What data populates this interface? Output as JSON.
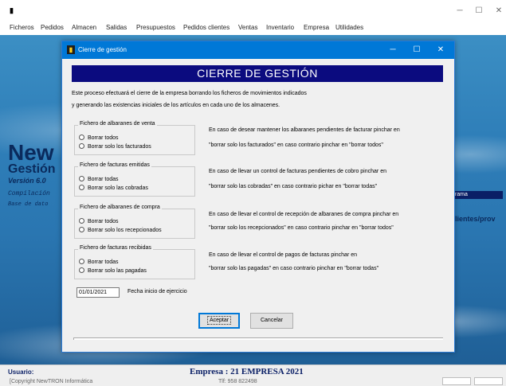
{
  "app": {
    "icon_glyph": "▮",
    "controls": {
      "minimize": "─",
      "maximize": "☐",
      "close": "✕"
    }
  },
  "menu": [
    "Ficheros",
    "Pedidos",
    "Almacen",
    "Salidas",
    "Presupuestos",
    "Pedidos clientes",
    "Ventas",
    "Inventario",
    "Empresa",
    "Utilidades"
  ],
  "background": {
    "brand_big": "New",
    "brand_sub": "Gestión",
    "version": "Versión 6.0",
    "compilacion": "Compilación",
    "base_datos": "Base de dato",
    "right_badge": "grama",
    "right_link": "clientes/prov"
  },
  "status": {
    "usuario": "Usuario:",
    "empresa": "Empresa : 21 EMPRESA 2021",
    "copyright": "[Copyright NewTRON Informática",
    "telefono": "Tlf: 958 822498"
  },
  "dialog": {
    "title": "Cierre de gestión",
    "icon_glyph": "▮",
    "controls": {
      "minimize": "─",
      "maximize": "☐",
      "close": "✕"
    },
    "banner": "CIERRE DE GESTIÓN",
    "intro_line1": "Este proceso efectuará el cierre de la empresa borrando los ficheros de movimientos indicados",
    "intro_line2": "y generando las existencias iniciales de los artículos en cada uno de los almacenes.",
    "groups": [
      {
        "legend": "Fichero de albaranes de venta",
        "options": [
          "Borrar todos",
          "Borrar solo los facturados"
        ],
        "desc_line1": "En caso de desear mantener los albaranes pendientes de facturar pinchar en",
        "desc_line2": "\"borrar solo los facturados\" en caso contrario pinchar en \"borrar todos\""
      },
      {
        "legend": "Fichero de facturas emitidas",
        "options": [
          "Borrar todas",
          "Borrar solo las cobradas"
        ],
        "desc_line1": "En caso de llevar un control de facturas pendientes de cobro pinchar en",
        "desc_line2": "\"borrar solo las cobradas\" en caso contrario pichar en \"borrar todas\""
      },
      {
        "legend": "Fichero de albaranes de compra",
        "options": [
          "Borrar todos",
          "Borrar solo los recepcionados"
        ],
        "desc_line1": "En caso de llevar el control de recepción de albaranes de compra pinchar en",
        "desc_line2": "\"borrar solo los recepcionados\" en caso contrario pinchar en \"borrar todos\""
      },
      {
        "legend": "Fichero de facturas recibidas",
        "options": [
          "Borrar todas",
          "Borrar solo las pagadas"
        ],
        "desc_line1": "En caso de llevar el control de pagos de facturas pinchar en",
        "desc_line2": "\"borrar solo las pagadas\" en caso contrario pinchar en \"borrar todas\""
      }
    ],
    "date_value": "01/01/2021",
    "date_label": "Fecha inicio de ejercicio",
    "accept_label": "Aceptar",
    "cancel_label": "Cancelar"
  }
}
